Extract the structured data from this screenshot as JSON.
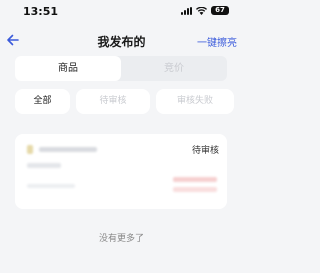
{
  "status_bar": {
    "time": "13:51",
    "battery": "67"
  },
  "nav": {
    "title": "我发布的",
    "action": "一键擦亮",
    "back_icon": "arrow-left-icon"
  },
  "segments": [
    {
      "label": "商品",
      "active": true
    },
    {
      "label": "竞价",
      "active": false
    }
  ],
  "filters": [
    {
      "label": "全部",
      "active": true
    },
    {
      "label": "待审核",
      "active": false
    },
    {
      "label": "审核失败",
      "active": false
    }
  ],
  "item": {
    "status": "待审核"
  },
  "footer": {
    "text": "没有更多了"
  },
  "colors": {
    "accent": "#3b5bdb",
    "background": "#f4f5f7"
  }
}
